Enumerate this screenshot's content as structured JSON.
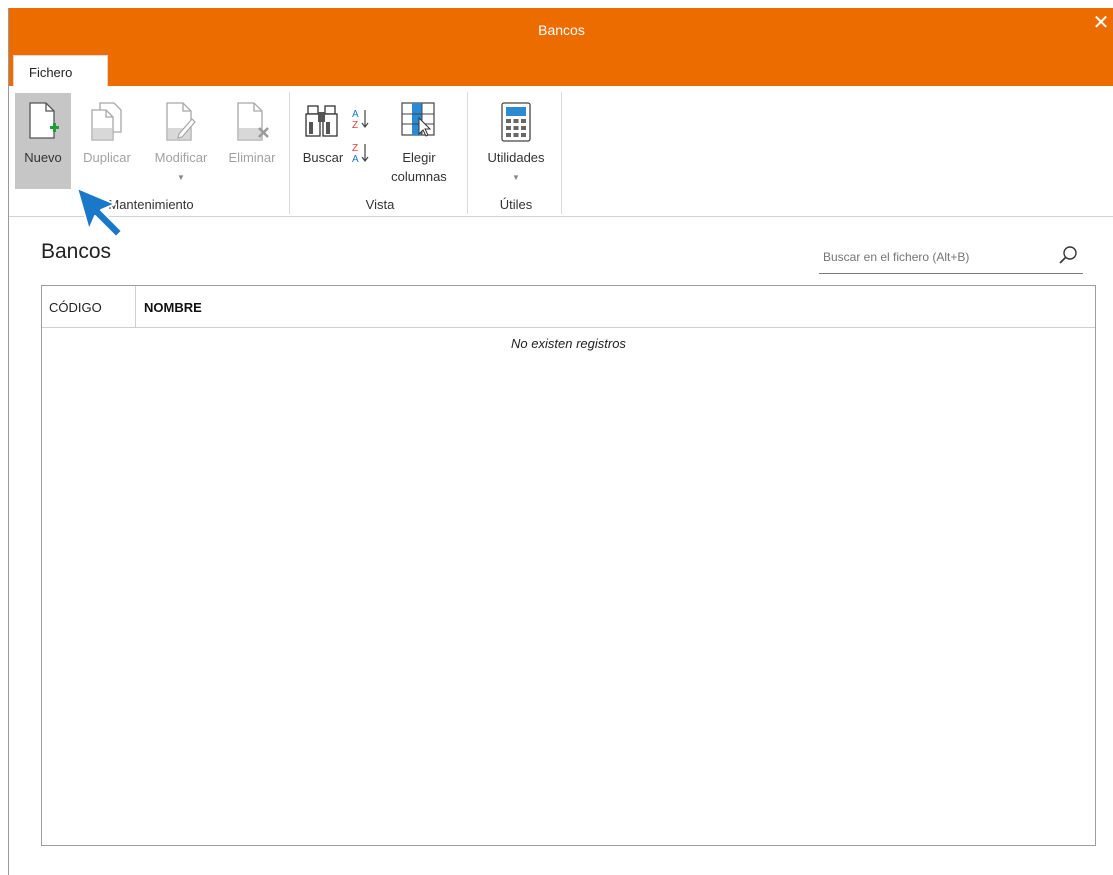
{
  "window": {
    "title": "Bancos",
    "close_glyph": "✕"
  },
  "tabs": [
    {
      "label": "Fichero",
      "active": true
    }
  ],
  "ribbon": {
    "mantenimiento": {
      "label": "Mantenimiento",
      "buttons": [
        {
          "label": "Nuevo",
          "icon": "new-document-icon",
          "enabled": true,
          "highlighted": true
        },
        {
          "label": "Duplicar",
          "icon": "duplicate-icon",
          "enabled": false
        },
        {
          "label": "Modificar",
          "icon": "edit-document-icon",
          "enabled": false,
          "has_dropdown": true
        },
        {
          "label": "Eliminar",
          "icon": "delete-document-icon",
          "enabled": false
        }
      ]
    },
    "vista": {
      "label": "Vista",
      "buttons": [
        {
          "label": "Buscar",
          "icon": "binoculars-icon",
          "enabled": true
        },
        {
          "label": "Sort ascending",
          "icon": "sort-az-icon",
          "enabled": true
        },
        {
          "label": "Sort descending",
          "icon": "sort-za-icon",
          "enabled": true
        },
        {
          "label": "Elegir",
          "label2": "columnas",
          "icon": "choose-columns-icon",
          "enabled": true
        }
      ]
    },
    "utiles": {
      "label": "Útiles",
      "buttons": [
        {
          "label": "Utilidades",
          "icon": "calculator-icon",
          "enabled": true,
          "has_dropdown": true
        }
      ]
    }
  },
  "page": {
    "title": "Bancos"
  },
  "search": {
    "placeholder": "Buscar en el fichero (Alt+B)",
    "value": ""
  },
  "grid": {
    "columns": [
      {
        "label": "CÓDIGO",
        "bold": false
      },
      {
        "label": "NOMBRE",
        "bold": true
      }
    ],
    "rows": [],
    "empty_message": "No existen registros"
  },
  "colors": {
    "accent": "#ec6c00",
    "highlight": "#c6c6c6",
    "cursor": "#1a78c8"
  }
}
